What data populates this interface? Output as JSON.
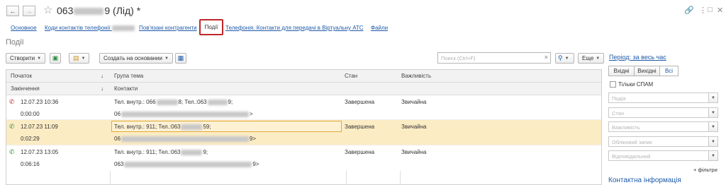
{
  "window": {
    "back_icon": "arrow-left-icon",
    "forward_icon": "arrow-right-icon",
    "title_prefix": "063",
    "title_suffix": "9 (Лід) *",
    "link_icon": "link-icon",
    "more_icon": "more-vert-icon",
    "maximize_icon": "maximize-icon",
    "close_icon": "close-icon"
  },
  "tabs": [
    {
      "label": "Основное"
    },
    {
      "label": "Коди контактів телефонії"
    },
    {
      "label": "Пов'язані контрагенти"
    },
    {
      "label": "Події",
      "active": true
    },
    {
      "label": "Телефонія. Контакти для передачі в Віртуальну АТС"
    },
    {
      "label": "Файли"
    }
  ],
  "section": {
    "title": "Події"
  },
  "toolbar": {
    "create_label": "Створити",
    "create_based_label": "Создать на основании",
    "search_placeholder": "Поиск (Ctrl+F)",
    "more_label": "Еще"
  },
  "table": {
    "headers": {
      "start": "Початок",
      "end": "Закінчення",
      "group": "Група тема",
      "contacts": "Контакти",
      "state": "Стан",
      "importance": "Важливість"
    },
    "rows": [
      {
        "direction_icon": "missed-call-icon",
        "start": "12.07.23 10:36",
        "duration": "0:00:00",
        "topic_a": "Тел. внутр.: 066",
        "topic_b": "8; Тел.:063",
        "topic_c": "9;",
        "contact_a": "06",
        "contact_b": ">",
        "state": "Завершена",
        "importance": "Звичайна",
        "selected": false
      },
      {
        "direction_icon": "incoming-call-icon",
        "start": "12.07.23 11:09",
        "duration": "0:02:29",
        "topic_a": "Тел. внутр.: 911; Тел.:063",
        "topic_b": "59;",
        "topic_c": "",
        "contact_a": "06",
        "contact_b": "9>",
        "state": "Завершена",
        "importance": "Звичайна",
        "selected": true
      },
      {
        "direction_icon": "incoming-call-icon",
        "start": "12.07.23 13:05",
        "duration": "0:06:16",
        "topic_a": "Тел. внутр.: 911; Тел.:063",
        "topic_b": "9;",
        "topic_c": "",
        "contact_a": "063",
        "contact_b": "9>",
        "state": "Завершена",
        "importance": "Звичайна",
        "selected": false
      }
    ]
  },
  "panel": {
    "period": "Період: за весь час",
    "segments": [
      "Вхідні",
      "Вихідні",
      "Всі"
    ],
    "active_segment": "Всі",
    "spam_label": "Тільки СПАМ",
    "filters": [
      "Подія",
      "Стан",
      "Важливість",
      "Обліковий запис",
      "Відповідальний"
    ],
    "more_filters": "+ фільтри",
    "contact_info": "Контактна інформація"
  },
  "colors": {
    "link": "#1e5aa8",
    "selected_row": "#fcecc4",
    "selected_cell_border": "#e2a93a",
    "active_tab_border": "#c0262a",
    "missed_call": "#c0262a",
    "incoming_call": "#2e8b3a"
  }
}
